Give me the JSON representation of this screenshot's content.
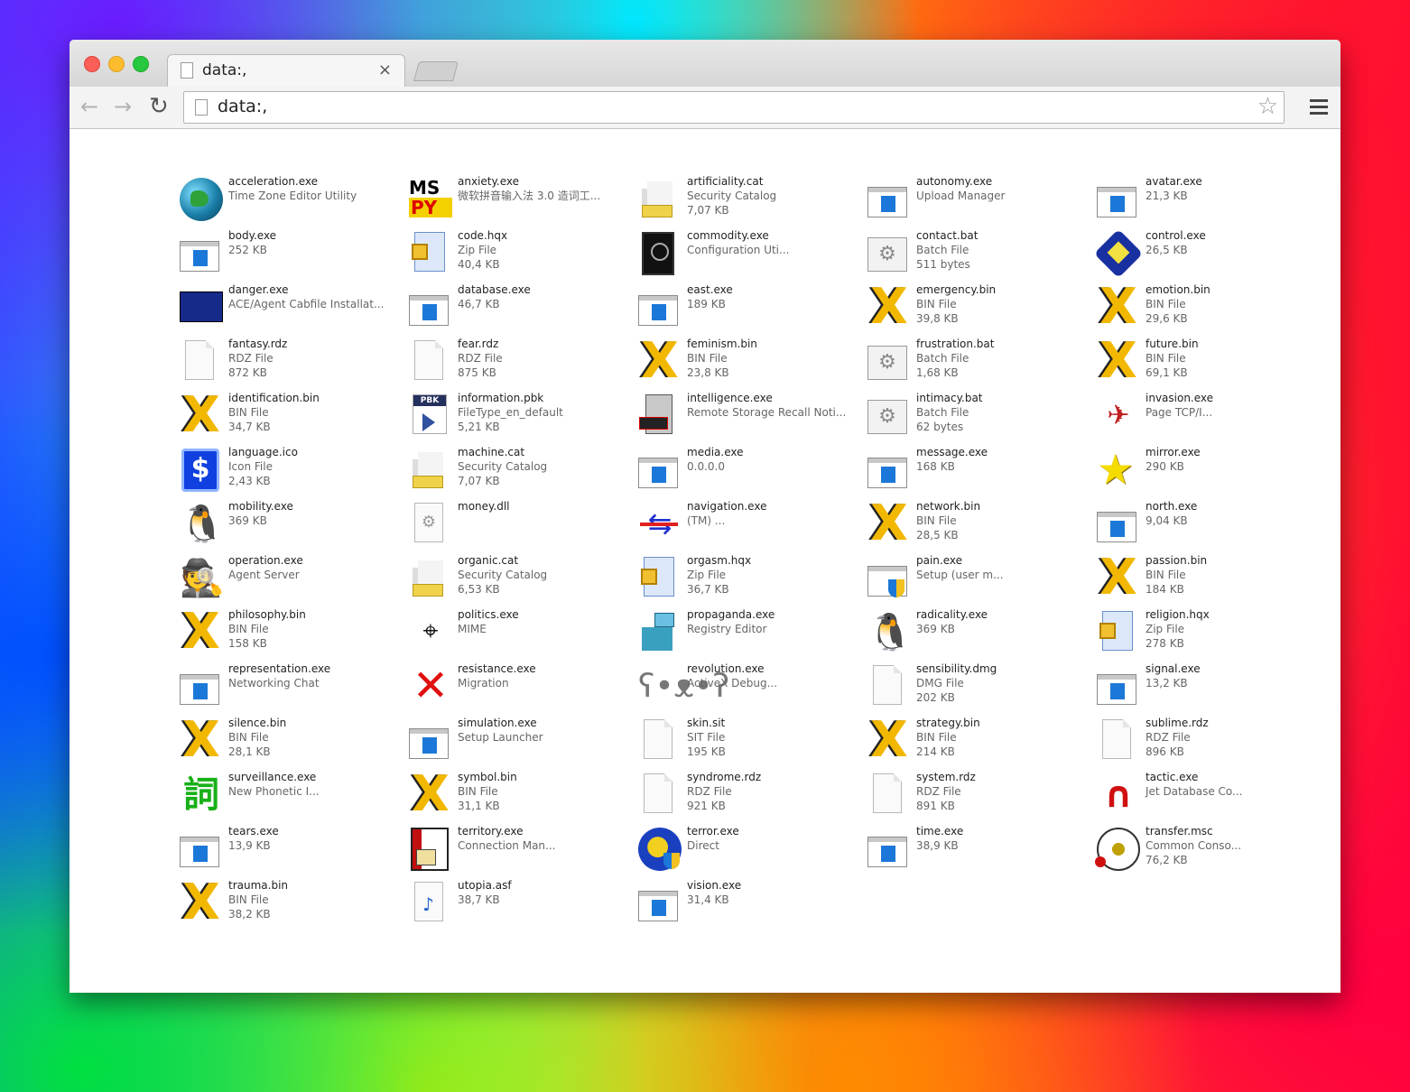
{
  "window": {
    "tab_title": "data:,",
    "tab_close": "×",
    "url": "data:,",
    "nav": {
      "back": "←",
      "forward": "→",
      "reload": "↻",
      "bookmark": "☆"
    }
  },
  "files": [
    {
      "name": "acceleration.exe",
      "desc": "Time Zone Editor Utility",
      "size": "",
      "icon": "globe-icon"
    },
    {
      "name": "anxiety.exe",
      "desc": "微软拼音输入法 3.0 造词工...",
      "size": "",
      "icon": "mspy-icon"
    },
    {
      "name": "artificiality.cat",
      "desc": "Security Catalog",
      "size": "7,07 KB",
      "icon": "catalog-icon"
    },
    {
      "name": "autonomy.exe",
      "desc": "Upload Manager",
      "size": "",
      "icon": "app-window-icon"
    },
    {
      "name": "avatar.exe",
      "desc": "21,3 KB",
      "size": "",
      "icon": "app-window-icon"
    },
    {
      "name": "body.exe",
      "desc": "252 KB",
      "size": "",
      "icon": "app-window-icon"
    },
    {
      "name": "code.hqx",
      "desc": "Zip File",
      "size": "40,4 KB",
      "icon": "zip-icon"
    },
    {
      "name": "commodity.exe",
      "desc": "Configuration Uti...",
      "size": "",
      "icon": "speaker-icon"
    },
    {
      "name": "contact.bat",
      "desc": "Batch File",
      "size": "511 bytes",
      "icon": "batch-gear-icon"
    },
    {
      "name": "control.exe",
      "desc": "26,5 KB",
      "size": "",
      "icon": "cube-icon"
    },
    {
      "name": "danger.exe",
      "desc": "ACE/Agent Cabfile Installat...",
      "size": "",
      "icon": "securid-icon"
    },
    {
      "name": "database.exe",
      "desc": "46,7 KB",
      "size": "",
      "icon": "app-window-icon"
    },
    {
      "name": "east.exe",
      "desc": "189 KB",
      "size": "",
      "icon": "app-window-icon"
    },
    {
      "name": "emergency.bin",
      "desc": "BIN File",
      "size": "39,8 KB",
      "icon": "x-icon"
    },
    {
      "name": "emotion.bin",
      "desc": "BIN File",
      "size": "29,6 KB",
      "icon": "x-icon"
    },
    {
      "name": "fantasy.rdz",
      "desc": "RDZ File",
      "size": "872 KB",
      "icon": "blank-doc-icon"
    },
    {
      "name": "fear.rdz",
      "desc": "RDZ File",
      "size": "875 KB",
      "icon": "blank-doc-icon"
    },
    {
      "name": "feminism.bin",
      "desc": "BIN File",
      "size": "23,8 KB",
      "icon": "x-icon"
    },
    {
      "name": "frustration.bat",
      "desc": "Batch File",
      "size": "1,68 KB",
      "icon": "batch-gear-icon"
    },
    {
      "name": "future.bin",
      "desc": "BIN File",
      "size": "69,1 KB",
      "icon": "x-icon"
    },
    {
      "name": "identification.bin",
      "desc": "BIN File",
      "size": "34,7 KB",
      "icon": "x-icon"
    },
    {
      "name": "information.pbk",
      "desc": "FileType_en_default",
      "size": "5,21 KB",
      "icon": "pbk-icon"
    },
    {
      "name": "intelligence.exe",
      "desc": "Remote Storage Recall Noti...",
      "size": "",
      "icon": "server-icon"
    },
    {
      "name": "intimacy.bat",
      "desc": "Batch File",
      "size": "62 bytes",
      "icon": "batch-gear-icon"
    },
    {
      "name": "invasion.exe",
      "desc": "Page TCP/I...",
      "size": "",
      "icon": "tcp-icon"
    },
    {
      "name": "language.ico",
      "desc": "Icon File",
      "size": "2,43 KB",
      "icon": "dollar-icon"
    },
    {
      "name": "machine.cat",
      "desc": "Security Catalog",
      "size": "7,07 KB",
      "icon": "catalog-icon"
    },
    {
      "name": "media.exe",
      "desc": "0.0.0.0",
      "size": "",
      "icon": "app-window-icon"
    },
    {
      "name": "message.exe",
      "desc": "168 KB",
      "size": "",
      "icon": "app-window-icon"
    },
    {
      "name": "mirror.exe",
      "desc": "290 KB",
      "size": "",
      "icon": "star-icon"
    },
    {
      "name": "mobility.exe",
      "desc": "369 KB",
      "size": "",
      "icon": "tux-icon"
    },
    {
      "name": "money.dll",
      "desc": "",
      "size": "",
      "icon": "dll-gear-icon"
    },
    {
      "name": "navigation.exe",
      "desc": "(TM) ...",
      "size": "",
      "icon": "usb-icon"
    },
    {
      "name": "network.bin",
      "desc": "BIN File",
      "size": "28,5 KB",
      "icon": "x-icon"
    },
    {
      "name": "north.exe",
      "desc": "9,04 KB",
      "size": "",
      "icon": "app-window-icon"
    },
    {
      "name": "operation.exe",
      "desc": "Agent Server",
      "size": "",
      "icon": "spy-icon"
    },
    {
      "name": "organic.cat",
      "desc": "Security Catalog",
      "size": "6,53 KB",
      "icon": "catalog-icon"
    },
    {
      "name": "orgasm.hqx",
      "desc": "Zip File",
      "size": "36,7 KB",
      "icon": "zip-icon"
    },
    {
      "name": "pain.exe",
      "desc": "Setup (user m...",
      "size": "",
      "icon": "uac-shield-icon"
    },
    {
      "name": "passion.bin",
      "desc": "BIN File",
      "size": "184 KB",
      "icon": "x-icon"
    },
    {
      "name": "philosophy.bin",
      "desc": "BIN File",
      "size": "158 KB",
      "icon": "x-icon"
    },
    {
      "name": "politics.exe",
      "desc": "MIME",
      "size": "",
      "icon": "mime-cursor-icon"
    },
    {
      "name": "propaganda.exe",
      "desc": "Registry Editor",
      "size": "",
      "icon": "registry-icon"
    },
    {
      "name": "radicality.exe",
      "desc": "369 KB",
      "size": "",
      "icon": "tux-icon"
    },
    {
      "name": "religion.hqx",
      "desc": "Zip File",
      "size": "278 KB",
      "icon": "zip-icon"
    },
    {
      "name": "representation.exe",
      "desc": "Networking Chat",
      "size": "",
      "icon": "app-window-icon"
    },
    {
      "name": "resistance.exe",
      "desc": "Migration",
      "size": "",
      "icon": "red-x-icon"
    },
    {
      "name": "revolution.exe",
      "desc": "ActiveX Debug...",
      "size": "",
      "icon": "koala-icon"
    },
    {
      "name": "sensibility.dmg",
      "desc": "DMG File",
      "size": "202 KB",
      "icon": "blank-doc-icon"
    },
    {
      "name": "signal.exe",
      "desc": "13,2 KB",
      "size": "",
      "icon": "app-window-icon"
    },
    {
      "name": "silence.bin",
      "desc": "BIN File",
      "size": "28,1 KB",
      "icon": "x-icon"
    },
    {
      "name": "simulation.exe",
      "desc": "Setup Launcher",
      "size": "",
      "icon": "app-window-icon"
    },
    {
      "name": "skin.sit",
      "desc": "SIT File",
      "size": "195 KB",
      "icon": "blank-doc-icon"
    },
    {
      "name": "strategy.bin",
      "desc": "BIN File",
      "size": "214 KB",
      "icon": "x-icon"
    },
    {
      "name": "sublime.rdz",
      "desc": "RDZ File",
      "size": "896 KB",
      "icon": "blank-doc-icon"
    },
    {
      "name": "surveillance.exe",
      "desc": "New Phonetic I...",
      "size": "",
      "icon": "phonetic-icon"
    },
    {
      "name": "symbol.bin",
      "desc": "BIN File",
      "size": "31,1 KB",
      "icon": "x-icon"
    },
    {
      "name": "syndrome.rdz",
      "desc": "RDZ File",
      "size": "921 KB",
      "icon": "blank-doc-icon"
    },
    {
      "name": "system.rdz",
      "desc": "RDZ File",
      "size": "891 KB",
      "icon": "blank-doc-icon"
    },
    {
      "name": "tactic.exe",
      "desc": "Jet Database Co...",
      "size": "",
      "icon": "magnet-icon"
    },
    {
      "name": "tears.exe",
      "desc": "13,9 KB",
      "size": "",
      "icon": "app-window-icon"
    },
    {
      "name": "territory.exe",
      "desc": "Connection Man...",
      "size": "",
      "icon": "phonebook-icon"
    },
    {
      "name": "terror.exe",
      "desc": "Direct",
      "size": "",
      "icon": "direct-icon"
    },
    {
      "name": "time.exe",
      "desc": "38,9 KB",
      "size": "",
      "icon": "app-window-icon"
    },
    {
      "name": "transfer.msc",
      "desc": "Common Conso...",
      "size": "76,2 KB",
      "icon": "console-icon"
    },
    {
      "name": "trauma.bin",
      "desc": "BIN File",
      "size": "38,2 KB",
      "icon": "x-icon"
    },
    {
      "name": "utopia.asf",
      "desc": "38,7 KB",
      "size": "",
      "icon": "media-doc-icon"
    },
    {
      "name": "vision.exe",
      "desc": "31,4 KB",
      "size": "",
      "icon": "app-window-icon"
    }
  ]
}
